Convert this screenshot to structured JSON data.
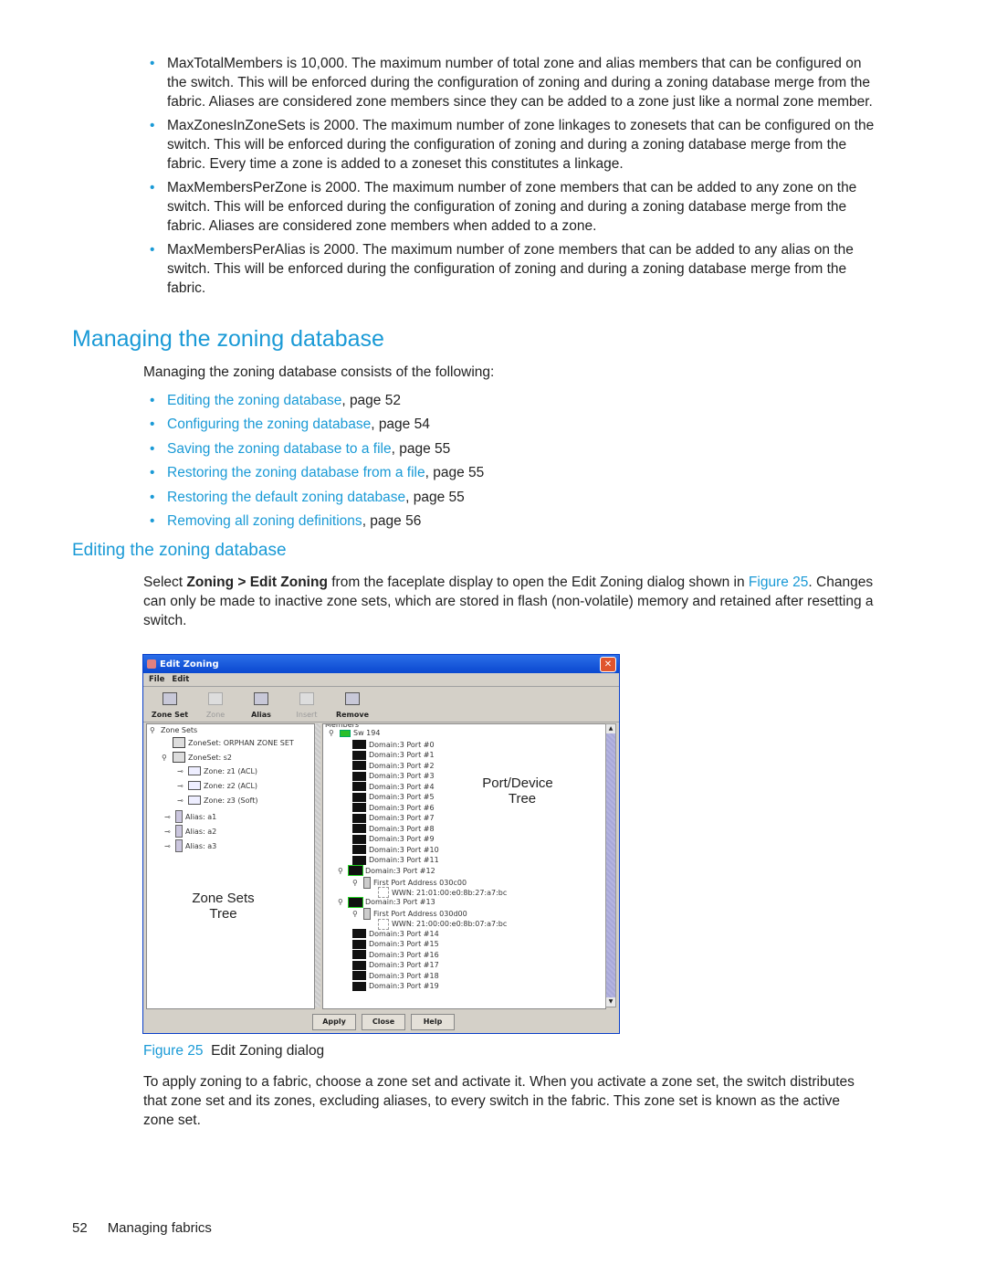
{
  "top_bullets": [
    "MaxTotalMembers is 10,000. The maximum number of total zone and alias members that can be configured on the switch. This will be enforced during the configuration of zoning and during a zoning database merge from the fabric. Aliases are considered zone members since they can be added to a zone just like a normal zone member.",
    "MaxZonesInZoneSets is 2000. The maximum number of zone linkages to zonesets that can be configured on the switch. This will be enforced during the configuration of zoning and during a zoning database merge from the fabric. Every time a zone is added to a zoneset this constitutes a linkage.",
    "MaxMembersPerZone is 2000. The maximum number of zone members that can be added to any zone on the switch. This will be enforced during the configuration of zoning and during a zoning database merge from the fabric. Aliases are considered zone members when added to a zone.",
    "MaxMembersPerAlias is 2000. The maximum number of zone members that can be added to any alias on the switch. This will be enforced during the configuration of zoning and during a zoning database merge from the fabric."
  ],
  "section": {
    "title": "Managing the zoning database",
    "intro": "Managing the zoning database consists of the following:",
    "links": [
      {
        "label": "Editing the zoning database",
        "suffix": ", page 52"
      },
      {
        "label": "Configuring the zoning database",
        "suffix": ", page 54"
      },
      {
        "label": "Saving the zoning database to a file",
        "suffix": ", page 55"
      },
      {
        "label": "Restoring the zoning database from a file",
        "suffix": ", page 55"
      },
      {
        "label": "Restoring the default zoning database",
        "suffix": ", page 55"
      },
      {
        "label": "Removing all zoning definitions",
        "suffix": ", page 56"
      }
    ]
  },
  "subsection": {
    "title": "Editing the zoning database",
    "p_pre": "Select ",
    "p_bold": "Zoning > Edit Zoning",
    "p_mid": " from the faceplate display to open the Edit Zoning dialog shown in ",
    "p_link": "Figure 25",
    "p_post": ". Changes can only be made to inactive zone sets, which are stored in flash (non-volatile) memory and retained after resetting a switch."
  },
  "dialog": {
    "title": "Edit Zoning",
    "close": "✕",
    "menu": [
      "File",
      "Edit"
    ],
    "toolbar": [
      {
        "label": "Zone Set",
        "enabled": true
      },
      {
        "label": "Zone",
        "enabled": false
      },
      {
        "label": "Alias",
        "enabled": true
      },
      {
        "label": "Insert",
        "enabled": false
      },
      {
        "label": "Remove",
        "enabled": true
      }
    ],
    "left_tree": {
      "root": "Zone Sets",
      "nodes": [
        "ZoneSet: ORPHAN ZONE SET",
        "ZoneSet: s2",
        "Zone: z1 (ACL)",
        "Zone: z2 (ACL)",
        "Zone: z3 (Soft)",
        "Alias: a1",
        "Alias: a2",
        "Alias: a3"
      ]
    },
    "right_tree": {
      "header": "Members",
      "switch": "Sw 194",
      "ports": [
        "Domain:3 Port #0",
        "Domain:3 Port #1",
        "Domain:3 Port #2",
        "Domain:3 Port #3",
        "Domain:3 Port #4",
        "Domain:3 Port #5",
        "Domain:3 Port #6",
        "Domain:3 Port #7",
        "Domain:3 Port #8",
        "Domain:3 Port #9",
        "Domain:3 Port #10",
        "Domain:3 Port #11",
        "Domain:3 Port #12",
        "First Port Address 030c00",
        "WWN: 21:01:00:e0:8b:27:a7:bc",
        "Domain:3 Port #13",
        "First Port Address 030d00",
        "WWN: 21:00:00:e0:8b:07:a7:bc",
        "Domain:3 Port #14",
        "Domain:3 Port #15",
        "Domain:3 Port #16",
        "Domain:3 Port #17",
        "Domain:3 Port #18",
        "Domain:3 Port #19"
      ]
    },
    "buttons": [
      "Apply",
      "Close",
      "Help"
    ],
    "annotations": {
      "left": [
        "Zone Sets",
        "Tree"
      ],
      "right": [
        "Port/Device",
        "Tree"
      ]
    }
  },
  "caption": {
    "fig": "Figure 25",
    "text": "  Edit Zoning dialog"
  },
  "closing": "To apply zoning to a fabric, choose a zone set and activate it. When you activate a zone set, the switch distributes that zone set and its zones, excluding aliases, to every switch in the fabric. This zone set is known as the active zone set.",
  "footer": {
    "page": "52",
    "chapter": "Managing fabrics"
  }
}
